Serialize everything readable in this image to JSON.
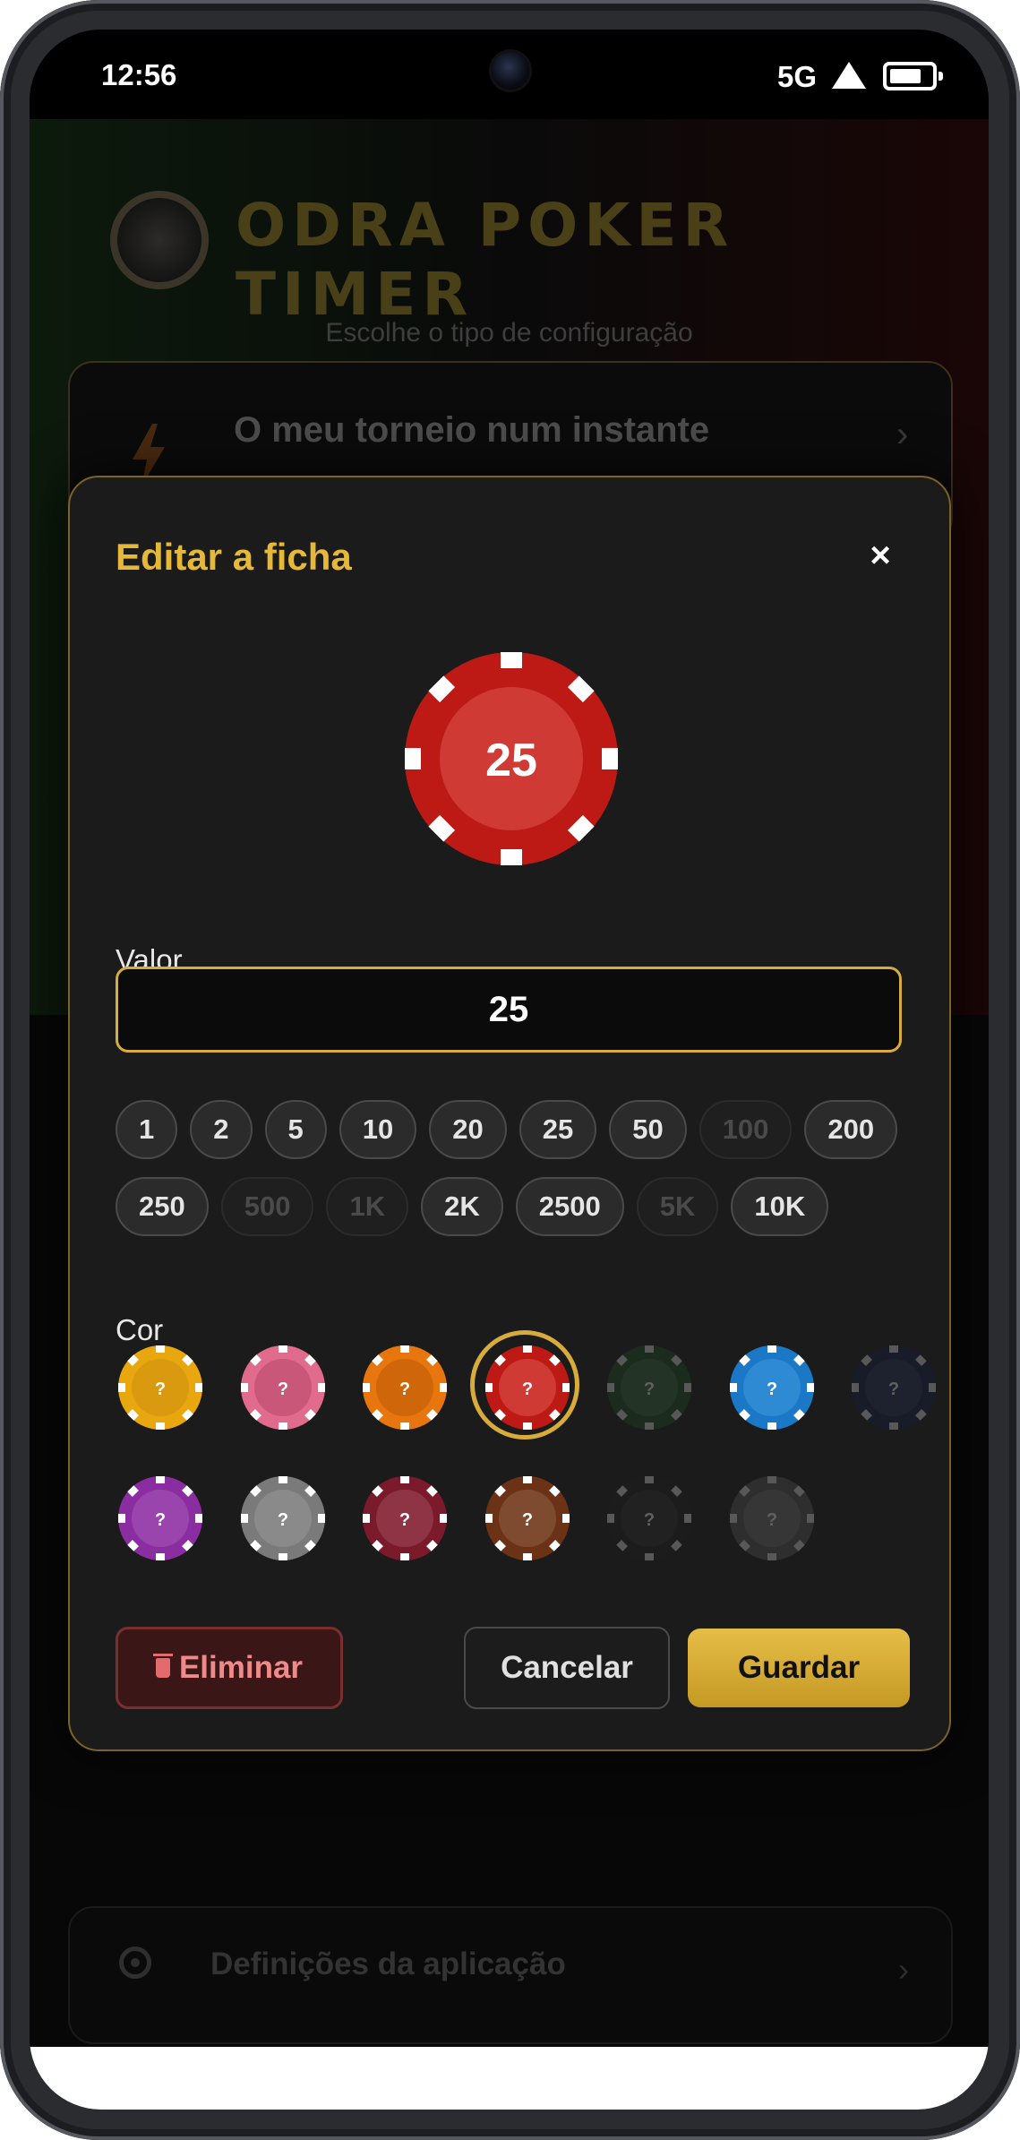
{
  "status_bar": {
    "time": "12:56",
    "network": "5G"
  },
  "background_app": {
    "title": "ODRA POKER TIMER",
    "subtitle": "Escolhe o tipo de configuração",
    "quick_card_title": "O meu torneio num instante",
    "settings_label": "Definições da aplicação"
  },
  "modal": {
    "title": "Editar a ficha",
    "close_label": "×",
    "preview_value": "25",
    "value_label": "Valor",
    "value_input": "25",
    "quick_values": [
      [
        {
          "label": "1",
          "enabled": true
        },
        {
          "label": "2",
          "enabled": true
        },
        {
          "label": "5",
          "enabled": true
        },
        {
          "label": "10",
          "enabled": true
        },
        {
          "label": "20",
          "enabled": true
        },
        {
          "label": "25",
          "enabled": true
        },
        {
          "label": "50",
          "enabled": true
        },
        {
          "label": "100",
          "enabled": false
        },
        {
          "label": "200",
          "enabled": true
        }
      ],
      [
        {
          "label": "250",
          "enabled": true
        },
        {
          "label": "500",
          "enabled": false
        },
        {
          "label": "1K",
          "enabled": false
        },
        {
          "label": "2K",
          "enabled": true
        },
        {
          "label": "2500",
          "enabled": true
        },
        {
          "label": "5K",
          "enabled": false
        },
        {
          "label": "10K",
          "enabled": true
        }
      ]
    ],
    "color_label": "Cor",
    "colors": [
      {
        "name": "yellow",
        "color": "#e9a70f",
        "center": "#d99a10",
        "dim": false,
        "selected": false
      },
      {
        "name": "pink",
        "color": "#e06b8c",
        "center": "#c9577a",
        "dim": false,
        "selected": false
      },
      {
        "name": "orange",
        "color": "#e8760e",
        "center": "#d0660a",
        "dim": false,
        "selected": false
      },
      {
        "name": "red",
        "color": "#bd1a16",
        "center": "#cf3a34",
        "dim": false,
        "selected": true
      },
      {
        "name": "green",
        "color": "#1b3b24",
        "center": "#2a4a32",
        "dim": true,
        "selected": false
      },
      {
        "name": "blue",
        "color": "#1b78c6",
        "center": "#2e8ad2",
        "dim": false,
        "selected": false
      },
      {
        "name": "navy",
        "color": "#171b33",
        "center": "#21263f",
        "dim": true,
        "selected": false
      },
      {
        "name": "purple",
        "color": "#8a2da0",
        "center": "#9a45ae",
        "dim": false,
        "selected": false
      },
      {
        "name": "gray",
        "color": "#7a7a7a",
        "center": "#8a8a8a",
        "dim": false,
        "selected": false
      },
      {
        "name": "maroon",
        "color": "#7b1a2a",
        "center": "#8f3445",
        "dim": false,
        "selected": false
      },
      {
        "name": "brown",
        "color": "#6b3216",
        "center": "#7f4b30",
        "dim": false,
        "selected": false
      },
      {
        "name": "black",
        "color": "#1e1e1e",
        "center": "#262626",
        "dim": true,
        "selected": false
      },
      {
        "name": "dark-gray",
        "color": "#3f3f3f",
        "center": "#4d4d4d",
        "dim": true,
        "selected": false
      }
    ],
    "swatch_mark": "?",
    "delete_label": "Eliminar",
    "cancel_label": "Cancelar",
    "save_label": "Guardar"
  },
  "theme": {
    "accent": "#e6b83a",
    "chip_red": "#bd1a16"
  }
}
